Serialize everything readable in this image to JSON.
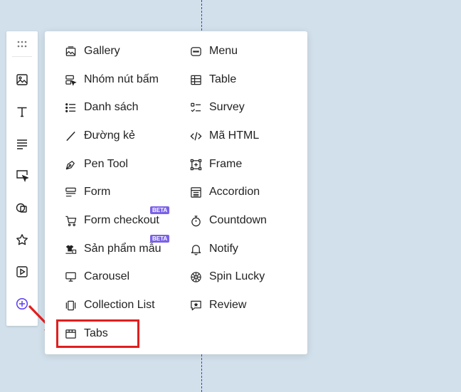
{
  "colors": {
    "accent": "#5b3df5",
    "highlight": "#e01f1f",
    "badge": "#7b61e8"
  },
  "toolbar": {
    "items": [
      {
        "icon": "grip-dots-icon"
      },
      {
        "icon": "image-icon"
      },
      {
        "icon": "text-icon"
      },
      {
        "icon": "paragraph-icon"
      },
      {
        "icon": "cursor-select-icon"
      },
      {
        "icon": "shapes-icon"
      },
      {
        "icon": "star-icon"
      },
      {
        "icon": "video-play-icon"
      },
      {
        "icon": "add-circle-icon"
      }
    ]
  },
  "menu": {
    "left": [
      {
        "label": "Gallery",
        "icon": "gallery-icon"
      },
      {
        "label": "Nhóm nút bấm",
        "icon": "button-group-icon"
      },
      {
        "label": "Danh sách",
        "icon": "list-icon"
      },
      {
        "label": "Đường kẻ",
        "icon": "line-icon"
      },
      {
        "label": "Pen Tool",
        "icon": "pen-tool-icon"
      },
      {
        "label": "Form",
        "icon": "form-icon"
      },
      {
        "label": "Form checkout",
        "icon": "cart-icon",
        "badge": "BETA"
      },
      {
        "label": "Sản phẩm mẫu",
        "icon": "product-sample-icon",
        "badge": "BETA"
      },
      {
        "label": "Carousel",
        "icon": "carousel-icon"
      },
      {
        "label": "Collection List",
        "icon": "collection-list-icon"
      },
      {
        "label": "Tabs",
        "icon": "tabs-icon"
      }
    ],
    "right": [
      {
        "label": "Menu",
        "icon": "menu-icon"
      },
      {
        "label": "Table",
        "icon": "table-icon"
      },
      {
        "label": "Survey",
        "icon": "survey-icon"
      },
      {
        "label": "Mã HTML",
        "icon": "code-icon"
      },
      {
        "label": "Frame",
        "icon": "frame-icon"
      },
      {
        "label": "Accordion",
        "icon": "accordion-icon"
      },
      {
        "label": "Countdown",
        "icon": "timer-icon"
      },
      {
        "label": "Notify",
        "icon": "bell-icon"
      },
      {
        "label": "Spin Lucky",
        "icon": "spin-wheel-icon"
      },
      {
        "label": "Review",
        "icon": "review-star-icon"
      }
    ]
  }
}
